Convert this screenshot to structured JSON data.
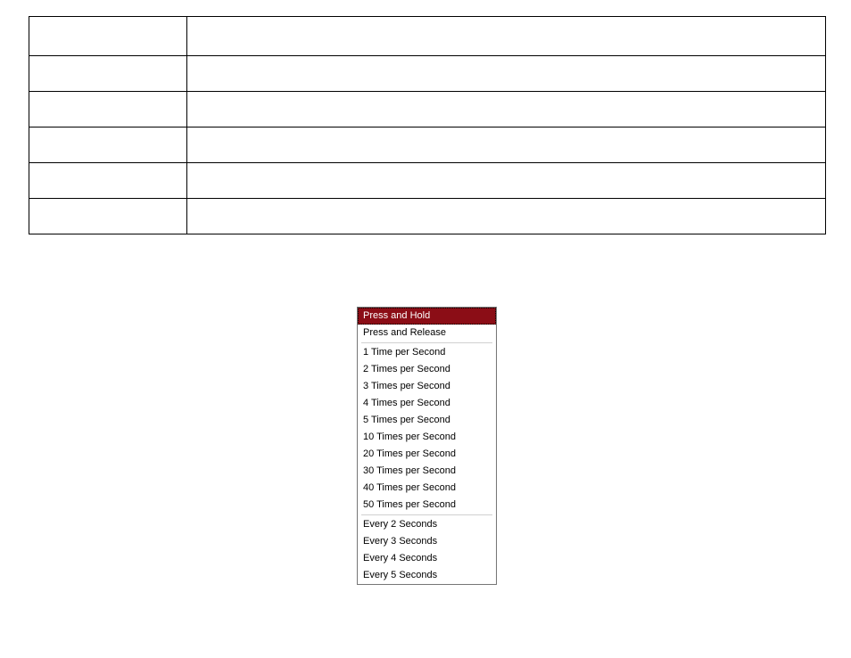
{
  "table": {
    "rows": 6,
    "cols": 2
  },
  "dropdown": {
    "groups": [
      [
        {
          "label": "Press and Hold",
          "selected": true
        },
        {
          "label": "Press and Release",
          "selected": false
        }
      ],
      [
        {
          "label": "1 Time per Second",
          "selected": false
        },
        {
          "label": "2 Times per Second",
          "selected": false
        },
        {
          "label": "3 Times per Second",
          "selected": false
        },
        {
          "label": "4 Times per Second",
          "selected": false
        },
        {
          "label": "5 Times per Second",
          "selected": false
        },
        {
          "label": "10 Times per Second",
          "selected": false
        },
        {
          "label": "20 Times per Second",
          "selected": false
        },
        {
          "label": "30 Times per Second",
          "selected": false
        },
        {
          "label": "40 Times per Second",
          "selected": false
        },
        {
          "label": "50 Times per Second",
          "selected": false
        }
      ],
      [
        {
          "label": "Every 2 Seconds",
          "selected": false
        },
        {
          "label": "Every 3 Seconds",
          "selected": false
        },
        {
          "label": "Every 4 Seconds",
          "selected": false
        },
        {
          "label": "Every 5 Seconds",
          "selected": false
        }
      ]
    ]
  }
}
